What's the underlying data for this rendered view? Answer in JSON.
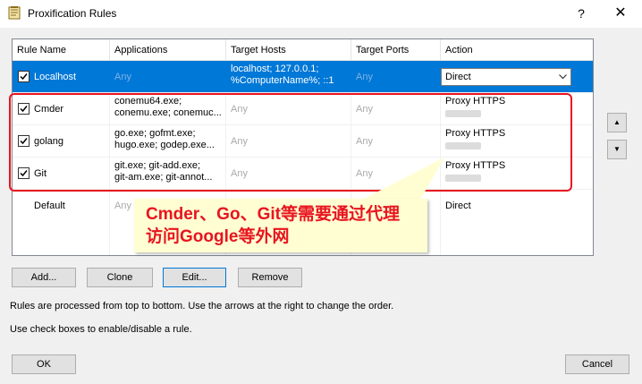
{
  "window": {
    "title": "Proxification Rules",
    "help_label": "?",
    "close_label": "✕"
  },
  "columns": [
    "Rule Name",
    "Applications",
    "Target Hosts",
    "Target Ports",
    "Action"
  ],
  "rules": [
    {
      "name": "Localhost",
      "checked": true,
      "selected": true,
      "apps": [
        "Any"
      ],
      "hosts": [
        "localhost; 127.0.0.1;",
        "%ComputerName%; ::1"
      ],
      "ports": "Any",
      "action": "Direct"
    },
    {
      "name": "Cmder",
      "checked": true,
      "apps": [
        "conemu64.exe;",
        "conemu.exe; conemuc..."
      ],
      "hosts": [
        "Any"
      ],
      "ports": "Any",
      "action": "Proxy HTTPS"
    },
    {
      "name": "golang",
      "checked": true,
      "apps": [
        "go.exe; gofmt.exe;",
        "hugo.exe; godep.exe..."
      ],
      "hosts": [
        "Any"
      ],
      "ports": "Any",
      "action": "Proxy HTTPS"
    },
    {
      "name": "Git",
      "checked": true,
      "apps": [
        "git.exe; git-add.exe;",
        "git-am.exe; git-annot..."
      ],
      "hosts": [
        "Any"
      ],
      "ports": "Any",
      "action": "Proxy HTTPS"
    },
    {
      "name": "Default",
      "checked": false,
      "apps": [
        "Any"
      ],
      "hosts": [
        "Any"
      ],
      "ports": "Any",
      "action": "Direct"
    }
  ],
  "annotation": {
    "line1": "Cmder、Go、Git等需要通过代理",
    "line2": "访问Google等外网",
    "color": "#e8141f"
  },
  "buttons": {
    "add": "Add...",
    "clone": "Clone",
    "edit": "Edit...",
    "remove": "Remove",
    "ok": "OK",
    "cancel": "Cancel"
  },
  "arrows": {
    "up": "▲",
    "down": "▼"
  },
  "notes": {
    "line1": "Rules are processed from top to bottom. Use the arrows at the right to change the order.",
    "line2": "Use check boxes to enable/disable a rule."
  }
}
